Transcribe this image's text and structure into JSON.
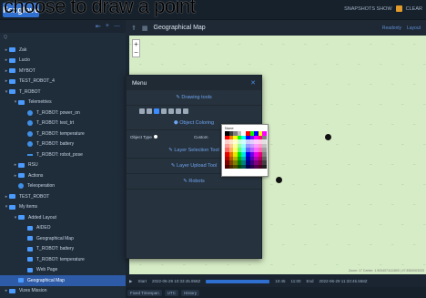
{
  "overlay_text": "choose to draw a point",
  "topbar": {
    "logo": "Foxglove",
    "right_items": [
      "SNAPSHOTS SHOW",
      "CLEAR"
    ]
  },
  "sidebar": {
    "search_placeholder": "Q",
    "items": [
      {
        "label": "Zak",
        "indent": 0,
        "kind": "folder",
        "expanded": false
      },
      {
        "label": "Lucio",
        "indent": 0,
        "kind": "folder",
        "expanded": false
      },
      {
        "label": "MYBOT",
        "indent": 0,
        "kind": "folder",
        "expanded": false
      },
      {
        "label": "TEST_ROBOT_4",
        "indent": 0,
        "kind": "folder",
        "expanded": false
      },
      {
        "label": "T_ROBOT",
        "indent": 0,
        "kind": "folder",
        "expanded": true
      },
      {
        "label": "Telemetries",
        "indent": 1,
        "kind": "folder",
        "expanded": true
      },
      {
        "label": "T_ROBOT: power_on",
        "indent": 2,
        "kind": "topic"
      },
      {
        "label": "T_ROBOT: test_trt",
        "indent": 2,
        "kind": "topic"
      },
      {
        "label": "T_ROBOT: temperature",
        "indent": 2,
        "kind": "topic"
      },
      {
        "label": "T_ROBOT: battery",
        "indent": 2,
        "kind": "topic"
      },
      {
        "label": "T_ROBOT: robot_pose",
        "indent": 2,
        "kind": "dash"
      },
      {
        "label": "RSU",
        "indent": 1,
        "kind": "folder"
      },
      {
        "label": "Actions",
        "indent": 1,
        "kind": "folder",
        "expanded": false
      },
      {
        "label": "Teleoperation",
        "indent": 1,
        "kind": "topic"
      },
      {
        "label": "TEST_ROBOT",
        "indent": 0,
        "kind": "folder",
        "expanded": false
      },
      {
        "label": "My items",
        "indent": 0,
        "kind": "folder",
        "expanded": true
      },
      {
        "label": "Added Layout",
        "indent": 1,
        "kind": "folder",
        "expanded": true
      },
      {
        "label": "AIDEO",
        "indent": 2,
        "kind": "sq"
      },
      {
        "label": "Geographical Map",
        "indent": 2,
        "kind": "sq"
      },
      {
        "label": "T_ROBOT: battery",
        "indent": 2,
        "kind": "sq"
      },
      {
        "label": "T_ROBOT: temperature",
        "indent": 2,
        "kind": "sq"
      },
      {
        "label": "Web Page",
        "indent": 2,
        "kind": "sq"
      },
      {
        "label": "Geographical Map",
        "indent": 1,
        "kind": "sq",
        "selected": true
      },
      {
        "label": "Vizes Mission",
        "indent": 0,
        "kind": "folder",
        "expanded": false
      }
    ]
  },
  "map_panel": {
    "title": "Geographical Map",
    "actions": [
      "Readonly",
      "Layout"
    ],
    "attribution": "Zoom: 17\nCenter: 1.9034071111800 | 47.8300003333",
    "timeline": {
      "start_label": "Start",
      "start": "2022-06-29 10:33:45.958Z",
      "mid": "10:45",
      "end_time": "11:00",
      "end_label": "End",
      "end": "2022-06-29 11:33:45.558Z"
    },
    "bottom": [
      "Fixed Timespan",
      "UTC",
      "History"
    ]
  },
  "menu": {
    "title": "Menu",
    "sections": {
      "drawing": "Drawing tools",
      "coloring": "Object Coloring",
      "object_type_label": "Object Type",
      "custom_label": "Custom",
      "layer_selection": "Layer Selection Tool",
      "layer_upload": "Layer Upload Tool",
      "robots": "Robots"
    }
  },
  "color_picker": {
    "none_label": "None",
    "swatches": [
      "#000000",
      "#3c3c3c",
      "#7d7d7d",
      "#bfbfbf",
      "#ffffff",
      "#ff0000",
      "#00ff00",
      "#0000ff",
      "#ffff00",
      "#ff00ff",
      "#ff0000",
      "#ff7f00",
      "#ffff00",
      "#00ff00",
      "#00ffff",
      "#0000ff",
      "#7f00ff",
      "#ff00ff",
      "#ff007f",
      "#7f7f7f",
      "#ffcccc",
      "#ffe5cc",
      "#ffffcc",
      "#ccffcc",
      "#ccffff",
      "#ccccff",
      "#e5ccff",
      "#ffccff",
      "#ffcce5",
      "#e0e0e0",
      "#ff9999",
      "#ffcc99",
      "#ffff99",
      "#99ff99",
      "#99ffff",
      "#9999ff",
      "#cc99ff",
      "#ff99ff",
      "#ff99cc",
      "#c0c0c0",
      "#ff6666",
      "#ffb266",
      "#ffff66",
      "#66ff66",
      "#66ffff",
      "#6666ff",
      "#b266ff",
      "#ff66ff",
      "#ff66b2",
      "#a0a0a0",
      "#e60000",
      "#e67300",
      "#e6e600",
      "#00e600",
      "#00e6e6",
      "#0000e6",
      "#7300e6",
      "#e600e6",
      "#e60073",
      "#808080",
      "#b30000",
      "#b35900",
      "#b3b300",
      "#00b300",
      "#00b3b3",
      "#0000b3",
      "#5900b3",
      "#b300b3",
      "#b30059",
      "#606060",
      "#800000",
      "#804000",
      "#808000",
      "#008000",
      "#008080",
      "#000080",
      "#400080",
      "#800080",
      "#800040",
      "#404040",
      "#4d0000",
      "#4d2600",
      "#4d4d00",
      "#004d00",
      "#004d4d",
      "#00004d",
      "#26004d",
      "#4d004d",
      "#4d0026",
      "#202020"
    ]
  }
}
